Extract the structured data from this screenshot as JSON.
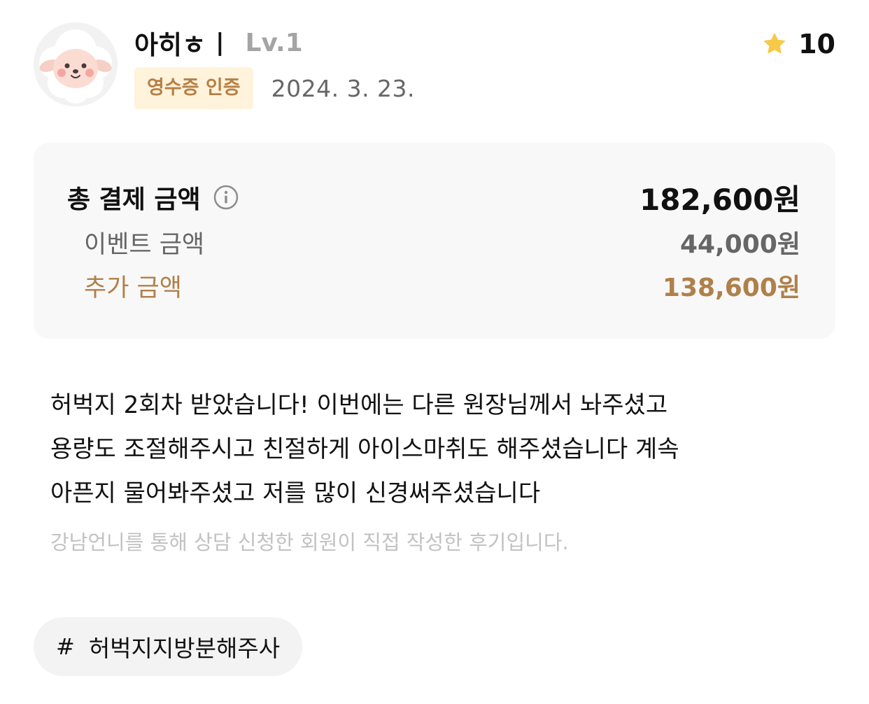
{
  "header": {
    "nickname": "아히ㅎ",
    "divider": "|",
    "level": "Lv.1",
    "badge": "영수증 인증",
    "date": "2024. 3. 23.",
    "rating": "10",
    "star_color": "#f7c948"
  },
  "price": {
    "total_label": "총 결제 금액",
    "total_value": "182,600원",
    "event_label": "이벤트 금액",
    "event_value": "44,000원",
    "extra_label": "추가 금액",
    "extra_value": "138,600원",
    "extra_color": "#b0804a"
  },
  "review": {
    "lines": [
      "허벅지 2회차 받았습니다! 이번에는 다른 원장님께서 놔주셨고",
      "용량도 조절해주시고 친절하게 아이스마취도 해주셨습니다 계속",
      "아픈지 물어봐주셨고 저를 많이 신경써주셨습니다"
    ],
    "disclaimer": "강남언니를 통해 상담 신청한 회원이 직접 작성한 후기입니다."
  },
  "hashtag": {
    "symbol": "#",
    "text": "허벅지지방분해주사"
  },
  "icons": {
    "avatar": "sheep-avatar-icon",
    "rating": "star-icon",
    "info": "info-icon"
  }
}
